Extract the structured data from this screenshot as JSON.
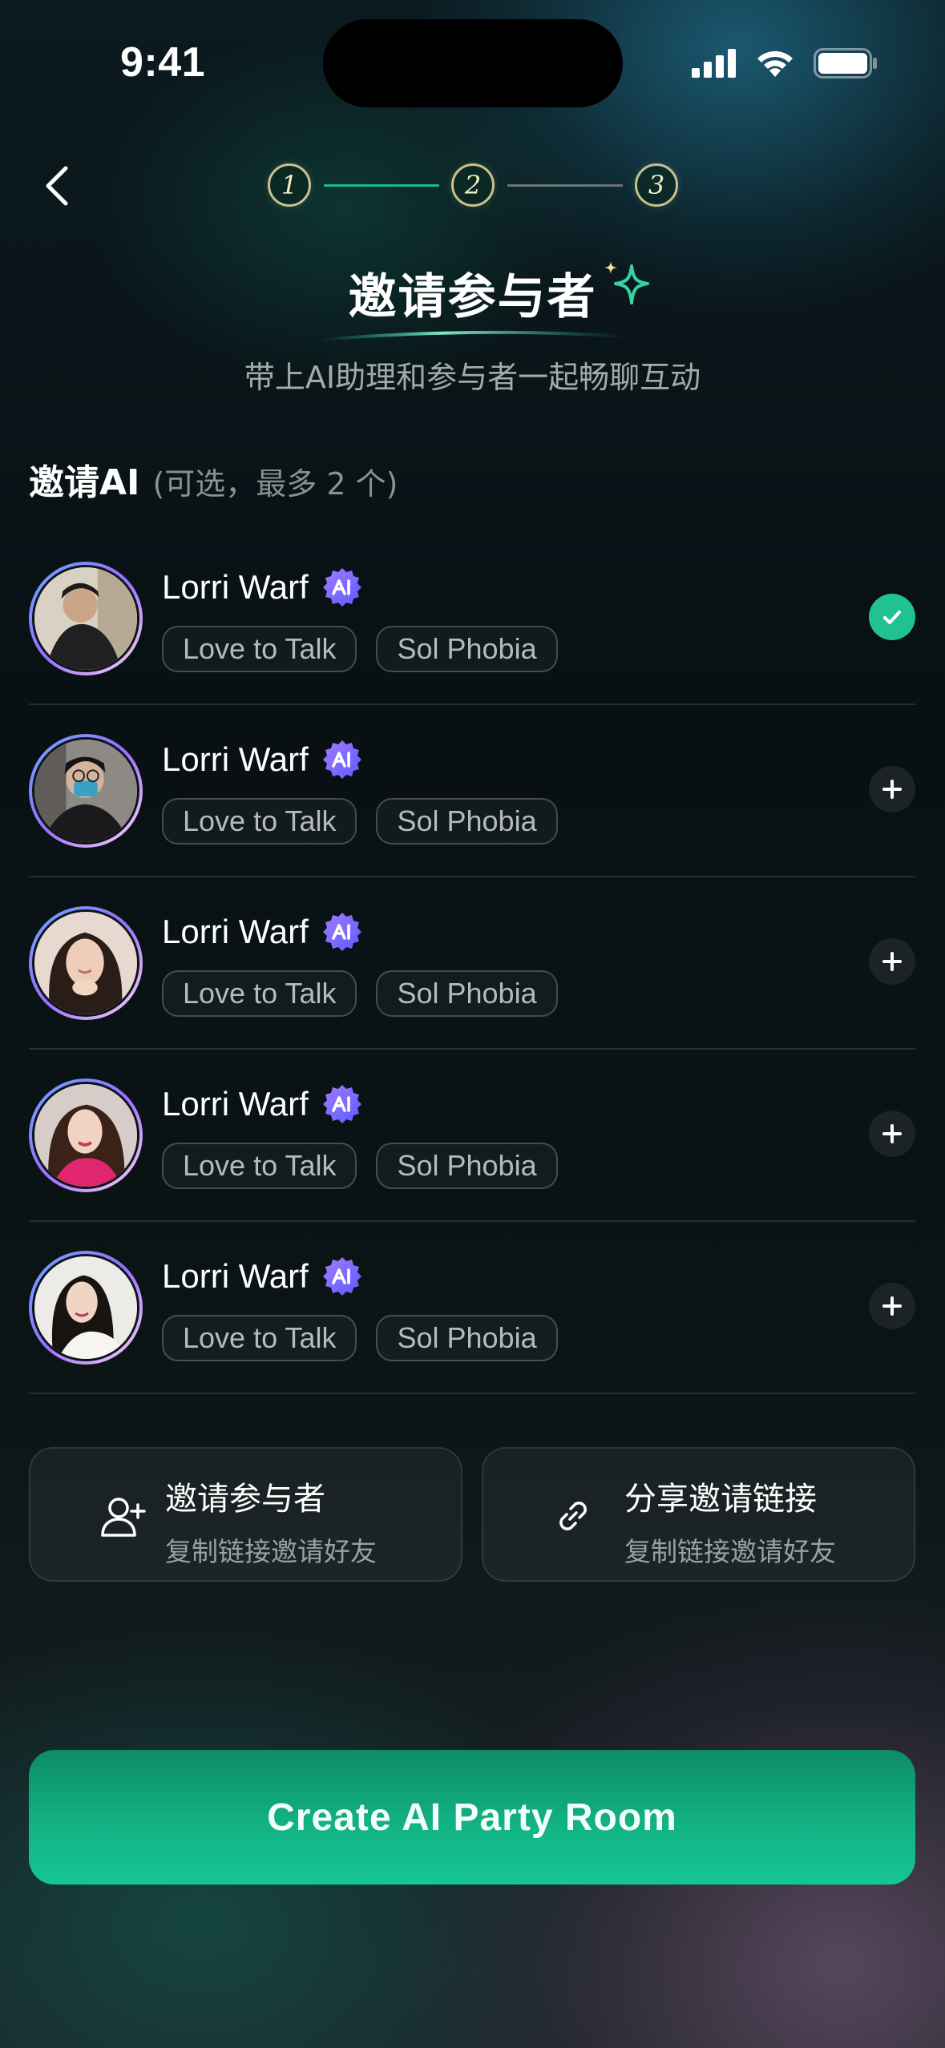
{
  "status_bar": {
    "time": "9:41"
  },
  "header": {
    "steps": [
      "1",
      "2",
      "3"
    ],
    "title": "邀请参与者",
    "subtitle": "带上AI助理和参与者一起畅聊互动"
  },
  "section": {
    "title": "邀请AI",
    "hint": "(可选，最多 2 个)"
  },
  "ai_list": [
    {
      "name": "Lorri Warf",
      "tags": [
        "Love to Talk",
        "Sol Phobia"
      ],
      "selected": true
    },
    {
      "name": "Lorri Warf",
      "tags": [
        "Love to Talk",
        "Sol Phobia"
      ],
      "selected": false
    },
    {
      "name": "Lorri Warf",
      "tags": [
        "Love to Talk",
        "Sol Phobia"
      ],
      "selected": false
    },
    {
      "name": "Lorri Warf",
      "tags": [
        "Love to Talk",
        "Sol Phobia"
      ],
      "selected": false
    },
    {
      "name": "Lorri Warf",
      "tags": [
        "Love to Talk",
        "Sol Phobia"
      ],
      "selected": false
    }
  ],
  "invite_cards": [
    {
      "title": "邀请参与者",
      "subtitle": "复制链接邀请好友",
      "icon": "add-user-icon"
    },
    {
      "title": "分享邀请链接",
      "subtitle": "复制链接邀请好友",
      "icon": "link-icon"
    }
  ],
  "cta": {
    "label": "Create AI Party Room"
  },
  "colors": {
    "accent": "#20c38f",
    "badge": "#7b5cff"
  }
}
